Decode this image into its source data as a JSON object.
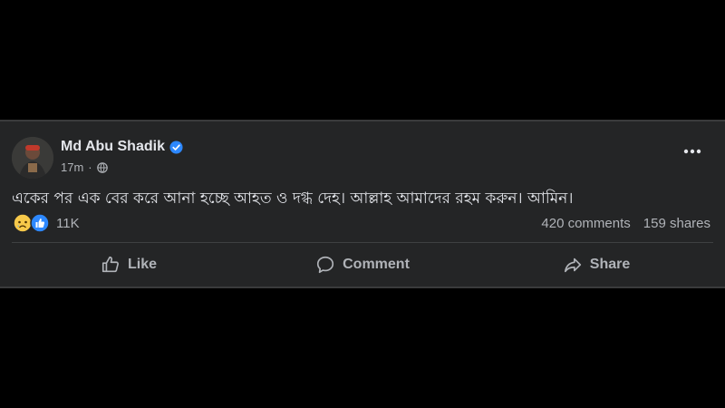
{
  "post": {
    "author": "Md Abu Shadik",
    "time": "17m",
    "text": "একের পর এক বের করে আনা হচ্ছে আহত ও দগ্ধ দেহ। আল্লাহ আমাদের রহম করুন। আমিন।",
    "reaction_count": "11K",
    "comments": "420 comments",
    "shares": "159 shares",
    "reactions": [
      "sad-icon",
      "like-icon"
    ]
  },
  "actions": {
    "like": "Like",
    "comment": "Comment",
    "share": "Share"
  },
  "colors": {
    "background": "#000000",
    "card": "#242526",
    "primary_text": "#e4e6eb",
    "secondary_text": "#b0b3b8",
    "verified": "#2d88ff"
  }
}
